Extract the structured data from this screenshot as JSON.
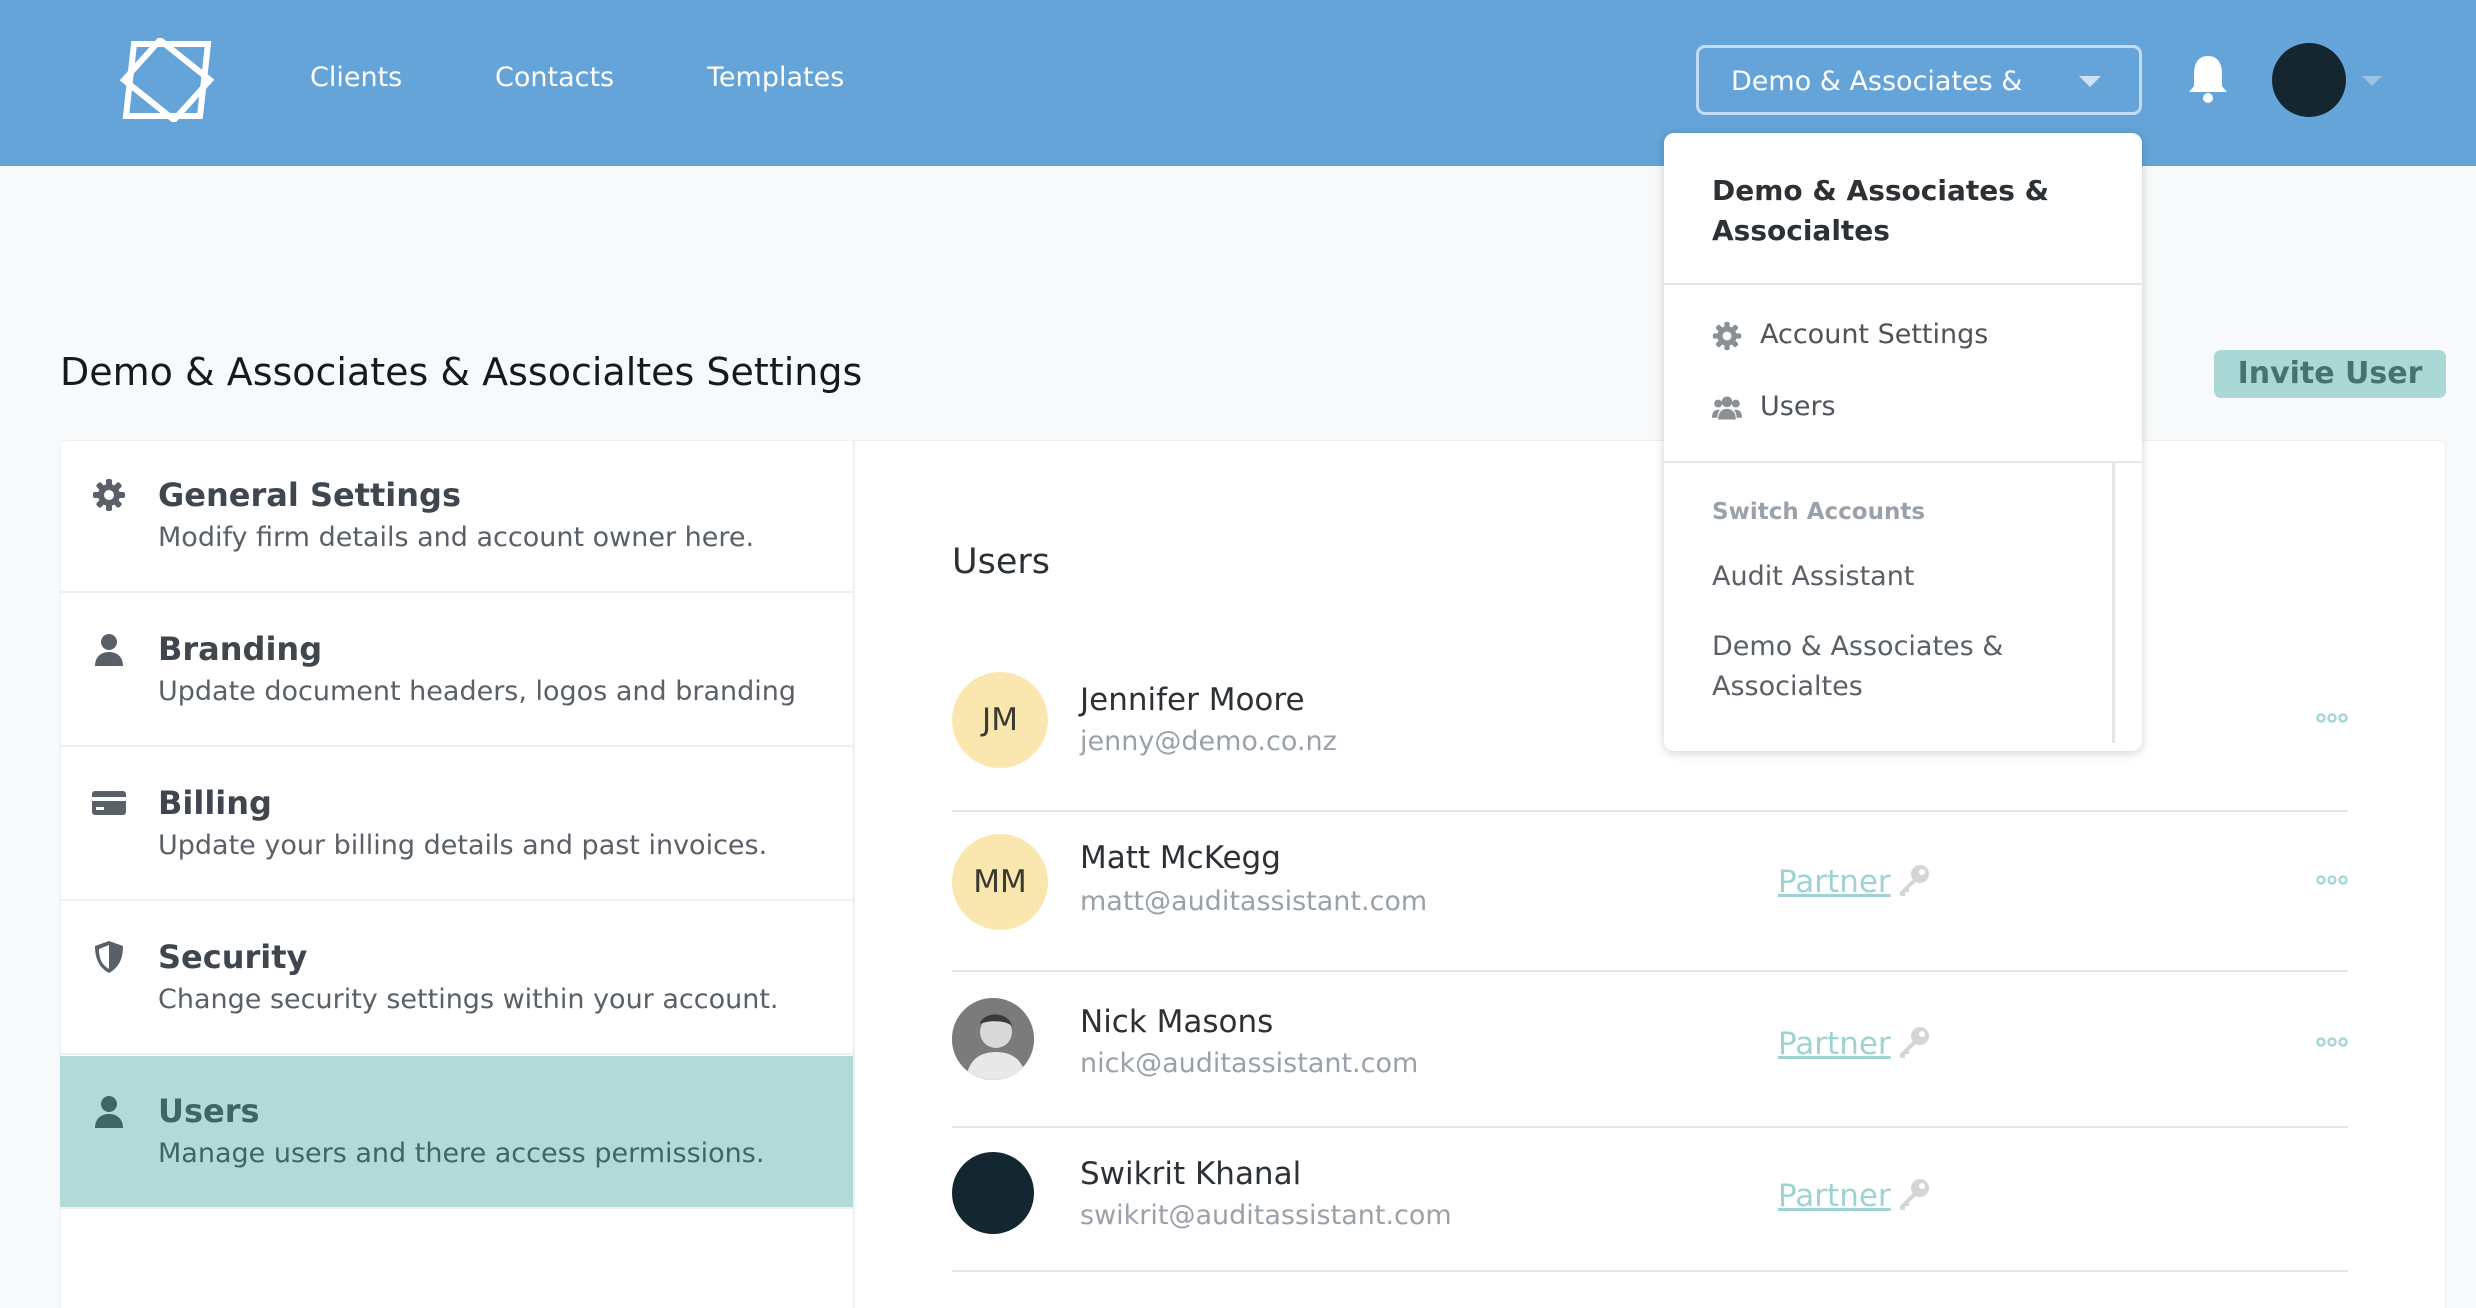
{
  "nav": {
    "links": [
      "Clients",
      "Contacts",
      "Templates"
    ],
    "account_select": "Demo & Associates &"
  },
  "page": {
    "title": "Demo & Associates & Associaltes Settings",
    "invite_button": "Invite User"
  },
  "sidebar": {
    "items": [
      {
        "icon": "gear-icon",
        "title": "General Settings",
        "desc": "Modify firm details and account owner here."
      },
      {
        "icon": "person-icon",
        "title": "Branding",
        "desc": "Update document headers, logos and branding"
      },
      {
        "icon": "credit-card-icon",
        "title": "Billing",
        "desc": "Update your billing details and past invoices."
      },
      {
        "icon": "shield-icon",
        "title": "Security",
        "desc": "Change security settings within your account."
      },
      {
        "icon": "person-icon",
        "title": "Users",
        "desc": "Manage users and there access permissions.",
        "active": true
      }
    ]
  },
  "users": {
    "heading": "Users",
    "rows": [
      {
        "initials": "JM",
        "name": "Jennifer Moore",
        "email": "jenny@demo.co.nz",
        "role": ""
      },
      {
        "initials": "MM",
        "name": "Matt McKegg",
        "email": "matt@auditassistant.com",
        "role": "Partner"
      },
      {
        "initials": "",
        "name": "Nick Masons",
        "email": "nick@auditassistant.com",
        "role": "Partner"
      },
      {
        "initials": "",
        "name": "Swikrit Khanal",
        "email": "swikrit@auditassistant.com",
        "role": "Partner"
      }
    ]
  },
  "dropdown": {
    "account_name": "Demo & Associates & Associaltes",
    "items": [
      {
        "icon": "gear-icon",
        "label": "Account Settings"
      },
      {
        "icon": "users-icon",
        "label": "Users"
      }
    ],
    "switch_heading": "Switch Accounts",
    "switch_items": [
      "Audit Assistant",
      "Demo & Associates & Associaltes"
    ]
  },
  "colors": {
    "header": "#64a4d9",
    "accent": "#b2dbd8",
    "role_link": "#9fd3d3"
  }
}
